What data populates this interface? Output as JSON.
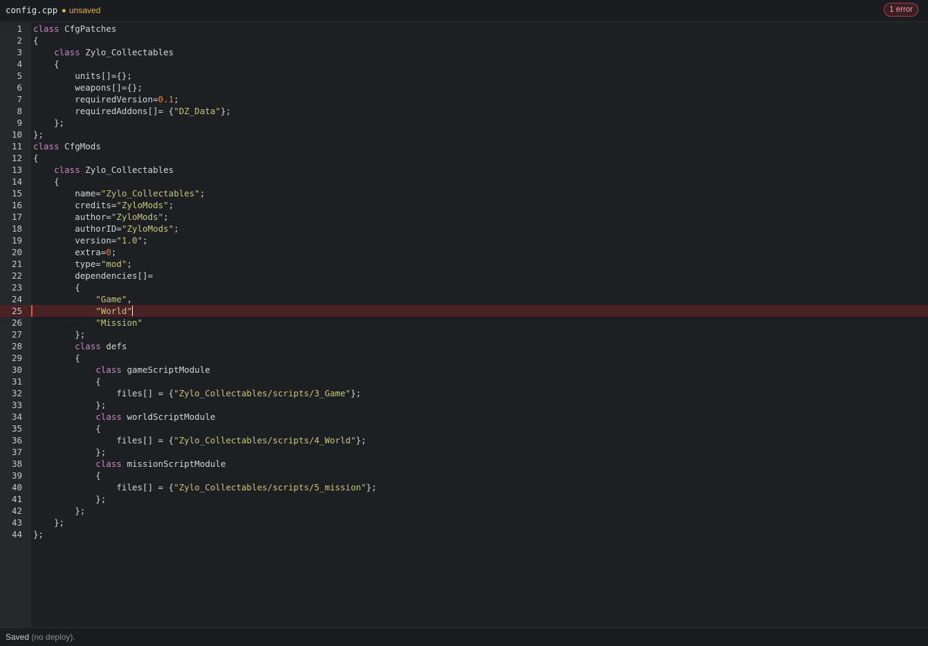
{
  "header": {
    "file_name": "config.cpp",
    "unsaved_label": "unsaved",
    "error_badge": "1 error"
  },
  "editor": {
    "error_line": 25,
    "lines": [
      [
        [
          "kw",
          "class"
        ],
        [
          "t",
          " CfgPatches"
        ]
      ],
      [
        [
          "t",
          "{"
        ]
      ],
      [
        [
          "t",
          "    "
        ],
        [
          "kw",
          "class"
        ],
        [
          "t",
          " Zylo_Collectables"
        ]
      ],
      [
        [
          "t",
          "    {"
        ]
      ],
      [
        [
          "t",
          "        units[]={};"
        ]
      ],
      [
        [
          "t",
          "        weapons[]={};"
        ]
      ],
      [
        [
          "t",
          "        requiredVersion="
        ],
        [
          "num",
          "0.1"
        ],
        [
          "t",
          ";"
        ]
      ],
      [
        [
          "t",
          "        requiredAddons[]= {"
        ],
        [
          "str",
          "\"DZ_Data\""
        ],
        [
          "t",
          "};"
        ]
      ],
      [
        [
          "t",
          "    };"
        ]
      ],
      [
        [
          "t",
          "};"
        ]
      ],
      [
        [
          "kw",
          "class"
        ],
        [
          "t",
          " CfgMods"
        ]
      ],
      [
        [
          "t",
          "{"
        ]
      ],
      [
        [
          "t",
          "    "
        ],
        [
          "kw",
          "class"
        ],
        [
          "t",
          " Zylo_Collectables"
        ]
      ],
      [
        [
          "t",
          "    {"
        ]
      ],
      [
        [
          "t",
          "        name="
        ],
        [
          "str",
          "\"Zylo_Collectables\""
        ],
        [
          "t",
          ";"
        ]
      ],
      [
        [
          "t",
          "        credits="
        ],
        [
          "str",
          "\"ZyloMods\""
        ],
        [
          "t",
          ";"
        ]
      ],
      [
        [
          "t",
          "        author="
        ],
        [
          "str",
          "\"ZyloMods\""
        ],
        [
          "t",
          ";"
        ]
      ],
      [
        [
          "t",
          "        authorID="
        ],
        [
          "str",
          "\"ZyloMods\""
        ],
        [
          "t",
          ";"
        ]
      ],
      [
        [
          "t",
          "        version="
        ],
        [
          "str",
          "\"1.0\""
        ],
        [
          "t",
          ";"
        ]
      ],
      [
        [
          "t",
          "        extra="
        ],
        [
          "num",
          "0"
        ],
        [
          "t",
          ";"
        ]
      ],
      [
        [
          "t",
          "        type="
        ],
        [
          "str",
          "\"mod\""
        ],
        [
          "t",
          ";"
        ]
      ],
      [
        [
          "t",
          "        dependencies[]="
        ]
      ],
      [
        [
          "t",
          "        {"
        ]
      ],
      [
        [
          "t",
          "            "
        ],
        [
          "str",
          "\"Game\""
        ],
        [
          "t",
          ","
        ]
      ],
      [
        [
          "t",
          "            "
        ],
        [
          "str",
          "\"World\""
        ],
        [
          "caret",
          ""
        ]
      ],
      [
        [
          "t",
          "            "
        ],
        [
          "str",
          "\"Mission\""
        ]
      ],
      [
        [
          "t",
          "        };"
        ]
      ],
      [
        [
          "t",
          "        "
        ],
        [
          "kw",
          "class"
        ],
        [
          "t",
          " defs"
        ]
      ],
      [
        [
          "t",
          "        {"
        ]
      ],
      [
        [
          "t",
          "            "
        ],
        [
          "kw",
          "class"
        ],
        [
          "t",
          " gameScriptModule"
        ]
      ],
      [
        [
          "t",
          "            {"
        ]
      ],
      [
        [
          "t",
          "                files[] = {"
        ],
        [
          "str",
          "\"Zylo_Collectables/scripts/3_Game\""
        ],
        [
          "t",
          "};"
        ]
      ],
      [
        [
          "t",
          "            };"
        ]
      ],
      [
        [
          "t",
          "            "
        ],
        [
          "kw",
          "class"
        ],
        [
          "t",
          " worldScriptModule"
        ]
      ],
      [
        [
          "t",
          "            {"
        ]
      ],
      [
        [
          "t",
          "                files[] = {"
        ],
        [
          "str",
          "\"Zylo_Collectables/scripts/4_World\""
        ],
        [
          "t",
          "};"
        ]
      ],
      [
        [
          "t",
          "            };"
        ]
      ],
      [
        [
          "t",
          "            "
        ],
        [
          "kw",
          "class"
        ],
        [
          "t",
          " missionScriptModule"
        ]
      ],
      [
        [
          "t",
          "            {"
        ]
      ],
      [
        [
          "t",
          "                files[] = {"
        ],
        [
          "str",
          "\"Zylo_Collectables/scripts/5_mission\""
        ],
        [
          "t",
          "};"
        ]
      ],
      [
        [
          "t",
          "            };"
        ]
      ],
      [
        [
          "t",
          "        };"
        ]
      ],
      [
        [
          "t",
          "    };"
        ]
      ],
      [
        [
          "t",
          "};"
        ]
      ]
    ]
  },
  "status": {
    "saved_label": "Saved",
    "detail": " (no deploy)."
  }
}
